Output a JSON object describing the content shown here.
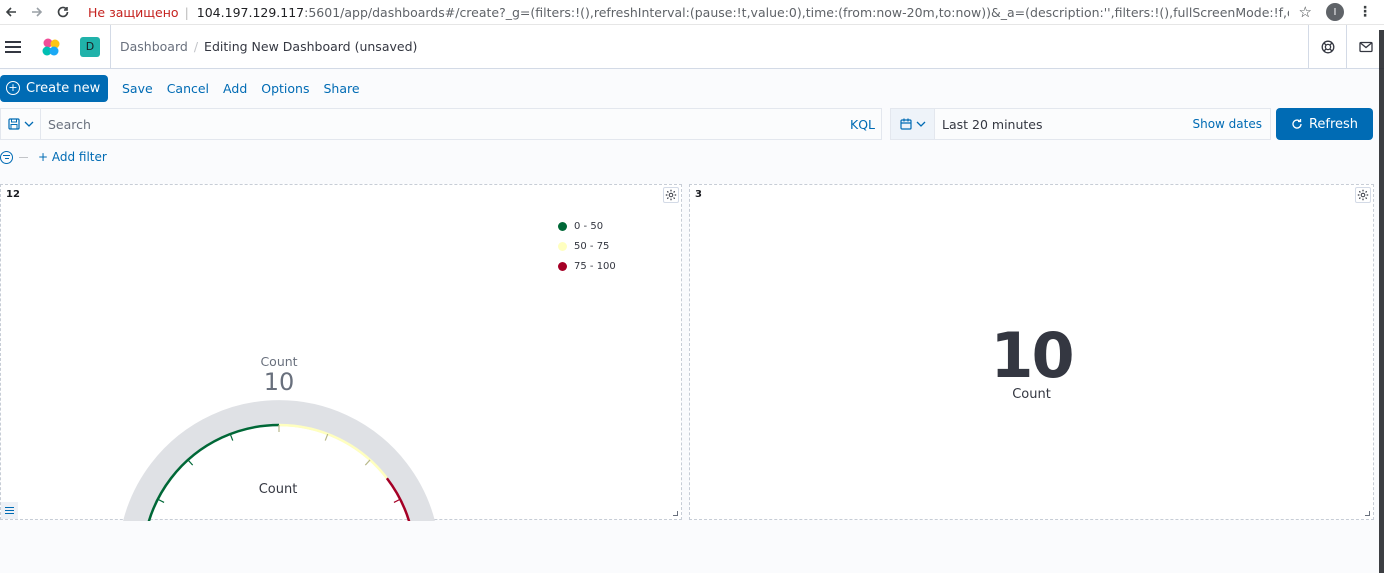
{
  "browser": {
    "security_label": "Не защищено",
    "url_host": "104.197.129.117",
    "url_rest": ":5601/app/dashboards#/create?_g=(filters:!(),refreshInterval:(pause:!t,value:0),time:(from:now-20m,to:now))&_a=(description:'',filters:!(),fullScreenMode:!f,options:(hidePanelTitles:!f,...",
    "profile_initial": "I"
  },
  "header": {
    "space_initial": "D",
    "breadcrumb_parent": "Dashboard",
    "breadcrumb_current": "Editing New Dashboard (unsaved)"
  },
  "menu": {
    "create_new": "Create new",
    "save": "Save",
    "cancel": "Cancel",
    "add": "Add",
    "options": "Options",
    "share": "Share"
  },
  "query": {
    "placeholder": "Search",
    "language": "KQL"
  },
  "time": {
    "range_label": "Last 20 minutes",
    "show_dates": "Show dates",
    "refresh": "Refresh"
  },
  "filters": {
    "add_filter": "+ Add filter"
  },
  "panels": [
    {
      "title": "12",
      "type": "gauge",
      "metric_label": "Count",
      "metric_value": "10",
      "caption": "Count",
      "legend": [
        {
          "label": "0 - 50",
          "color": "#006837"
        },
        {
          "label": "50 - 75",
          "color": "#ffffbf"
        },
        {
          "label": "75 - 100",
          "color": "#a50026"
        }
      ]
    },
    {
      "title": "3",
      "type": "metric",
      "metric_value": "10",
      "metric_label": "Count"
    }
  ],
  "chart_data": {
    "type": "gauge",
    "value": 10,
    "min": 0,
    "max": 100,
    "ranges": [
      {
        "from": 0,
        "to": 50,
        "color": "#006837"
      },
      {
        "from": 50,
        "to": 75,
        "color": "#ffffbf"
      },
      {
        "from": 75,
        "to": 100,
        "color": "#a50026"
      }
    ]
  },
  "colors": {
    "primary": "#006bb4",
    "gauge_track": "#dfe1e5",
    "space_badge": "#20b2aa"
  }
}
